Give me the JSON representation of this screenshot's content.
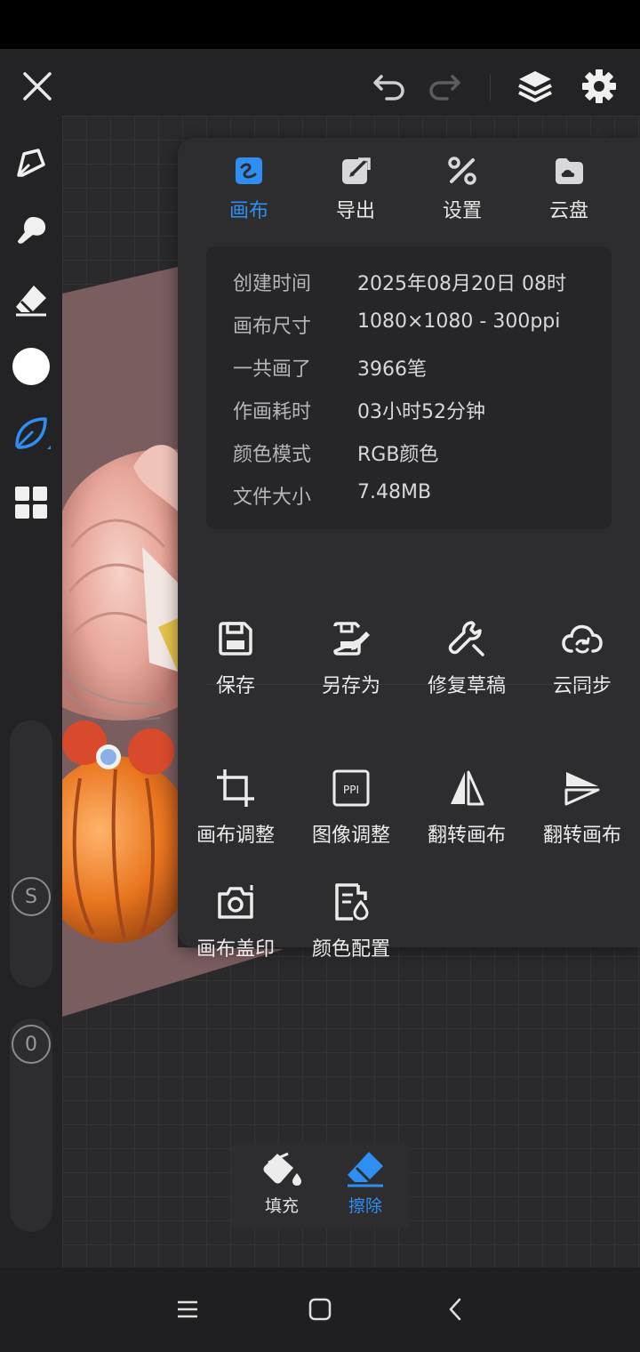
{
  "panel": {
    "tabs": [
      {
        "label": "画布",
        "icon": "canvas-icon",
        "active": true
      },
      {
        "label": "导出",
        "icon": "export-icon",
        "active": false
      },
      {
        "label": "设置",
        "icon": "settings-tools-icon",
        "active": false
      },
      {
        "label": "云盘",
        "icon": "cloud-drive-icon",
        "active": false
      }
    ],
    "info": [
      {
        "key": "创建时间",
        "value": "2025年08月20日 08时"
      },
      {
        "key": "画布尺寸",
        "value": "1080×1080 - 300ppi"
      },
      {
        "key": "一共画了",
        "value": "3966笔"
      },
      {
        "key": "作画耗时",
        "value": "03小时52分钟"
      },
      {
        "key": "颜色模式",
        "value": "RGB颜色"
      },
      {
        "key": "文件大小",
        "value": "7.48MB"
      }
    ],
    "actions": [
      {
        "label": "保存",
        "icon": "save-icon"
      },
      {
        "label": "另存为",
        "icon": "save-as-icon"
      },
      {
        "label": "修复草稿",
        "icon": "repair-wrench-icon"
      },
      {
        "label": "云同步",
        "icon": "cloud-sync-icon"
      },
      {
        "label": "画布调整",
        "icon": "crop-icon"
      },
      {
        "label": "图像调整",
        "icon": "ppi-icon"
      },
      {
        "label": "翻转画布",
        "icon": "flip-horizontal-icon"
      },
      {
        "label": "翻转画布",
        "icon": "flip-vertical-icon"
      },
      {
        "label": "画布盖印",
        "icon": "camera-stamp-icon"
      },
      {
        "label": "颜色配置",
        "icon": "color-profile-icon"
      }
    ]
  },
  "left_toolbar": {
    "slider_labels": [
      "S",
      "0"
    ],
    "selected_color": "#ffffff",
    "active_tool": "brush-leaf"
  },
  "bottom_tools": {
    "fill_label": "填充",
    "erase_label": "擦除",
    "active": "erase"
  },
  "colors": {
    "accent": "#2e8ef1",
    "panel_bg": "#2d2d30",
    "app_bg": "#232325"
  }
}
